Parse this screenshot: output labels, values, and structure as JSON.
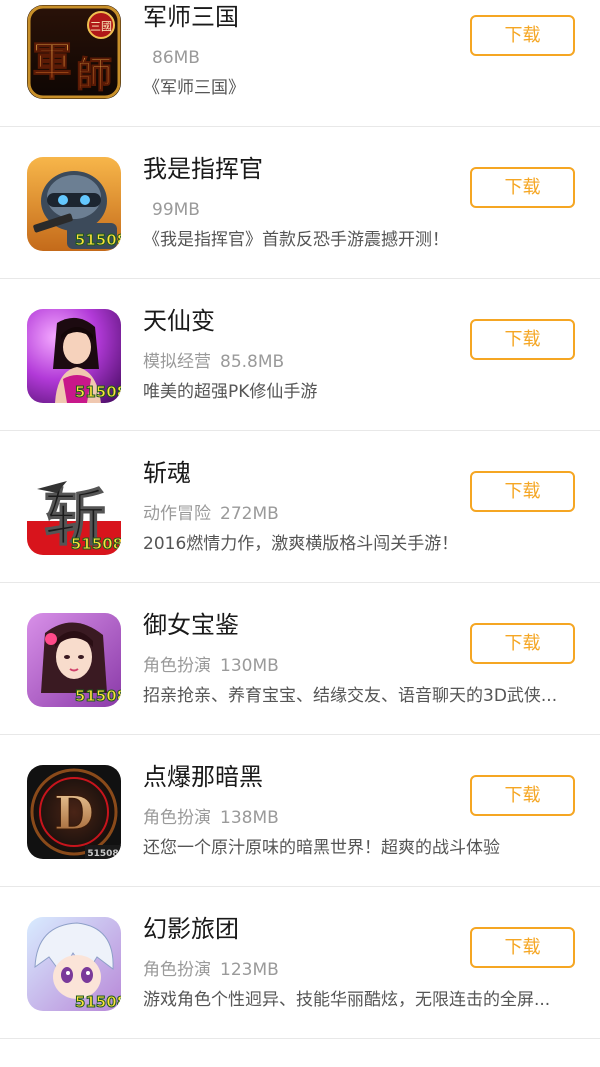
{
  "apps": [
    {
      "name": "军师三国",
      "category": "",
      "size": "86MB",
      "description": "《军师三国》",
      "button_label": "下载",
      "icon": "general-game-icon"
    },
    {
      "name": "我是指挥官",
      "category": "",
      "size": "99MB",
      "description": "《我是指挥官》首款反恐手游震撼开测！",
      "button_label": "下载",
      "icon": "commander-game-icon"
    },
    {
      "name": "天仙变",
      "category": "模拟经营",
      "size": "85.8MB",
      "description": "唯美的超强PK修仙手游",
      "button_label": "下载",
      "icon": "fairy-game-icon"
    },
    {
      "name": "斩魂",
      "category": "动作冒险",
      "size": "272MB",
      "description": "2016燃情力作，激爽横版格斗闯关手游！",
      "button_label": "下载",
      "icon": "soul-game-icon"
    },
    {
      "name": "御女宝鉴",
      "category": "角色扮演",
      "size": "130MB",
      "description": "招亲抢亲、养育宝宝、结缘交友、语音聊天的3D武侠...",
      "button_label": "下载",
      "icon": "heroine-game-icon"
    },
    {
      "name": "点爆那暗黑",
      "category": "角色扮演",
      "size": "138MB",
      "description": "还您一个原汁原味的暗黑世界！超爽的战斗体验",
      "button_label": "下载",
      "icon": "dark-d-game-icon"
    },
    {
      "name": "幻影旅团",
      "category": "角色扮演",
      "size": "123MB",
      "description": "游戏角色个性迥异、技能华丽酷炫，无限连击的全屏...",
      "button_label": "下载",
      "icon": "phantom-game-icon"
    }
  ],
  "badge_text": "51508",
  "icon_glyphs": [
    "三國",
    "軍",
    "師",
    "斩",
    "D"
  ],
  "colors": {
    "accent": "#f5a623",
    "title": "#1a1a1a",
    "meta": "#9a9a9a",
    "desc": "#555555",
    "divider": "#e8e8e8"
  }
}
